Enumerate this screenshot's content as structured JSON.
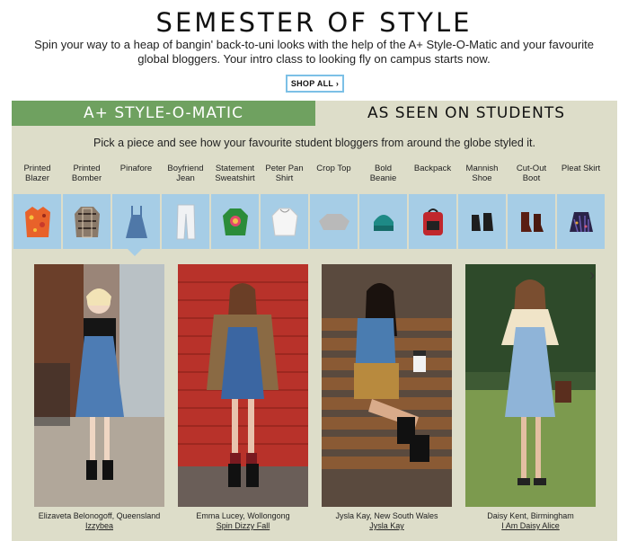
{
  "header": {
    "title": "SEMESTER OF STYLE",
    "intro": "Spin your way to a heap of bangin' back-to-uni looks with the help of the A+ Style-O-Matic and your favourite global bloggers. Your intro class to looking fly on campus starts now.",
    "shop_all_label": "SHOP ALL ›"
  },
  "tabs": [
    {
      "label": "A+ STYLE-O-MATIC",
      "active": true
    },
    {
      "label": "AS SEEN ON STUDENTS",
      "active": false
    }
  ],
  "instruction": "Pick a piece and see how your favourite student bloggers from around the globe styled it.",
  "pieces": [
    {
      "label": "Printed\nBlazer",
      "icon": "blazer-icon"
    },
    {
      "label": "Printed\nBomber",
      "icon": "bomber-icon"
    },
    {
      "label": "Pinafore",
      "icon": "pinafore-icon",
      "selected": true
    },
    {
      "label": "Boyfriend\nJean",
      "icon": "jeans-icon"
    },
    {
      "label": "Statement\nSweatshirt",
      "icon": "sweatshirt-icon"
    },
    {
      "label": "Peter Pan\nShirt",
      "icon": "shirt-icon"
    },
    {
      "label": "Crop Top",
      "icon": "crop-top-icon"
    },
    {
      "label": "Bold\nBeanie",
      "icon": "beanie-icon"
    },
    {
      "label": "Backpack",
      "icon": "backpack-icon"
    },
    {
      "label": "Mannish\nShoe",
      "icon": "shoe-icon"
    },
    {
      "label": "Cut-Out\nBoot",
      "icon": "boot-icon"
    },
    {
      "label": "Pleat Skirt",
      "icon": "skirt-icon"
    }
  ],
  "students": [
    {
      "name": "Elizaveta Belonogoff, Queensland",
      "blog": "Izzybea"
    },
    {
      "name": "Emma Lucey, Wollongong",
      "blog": "Spin Dizzy Fall"
    },
    {
      "name": "Jysla Kay, New South Wales",
      "blog": "Jysla Kay"
    },
    {
      "name": "Daisy Kent, Birmingham",
      "blog": "I Am Daisy Alice"
    }
  ],
  "navigation": {
    "next_icon": "chevron-right-icon",
    "next_label": "›"
  },
  "colors": {
    "tab_active": "#6fa160",
    "panel_bg": "#ddddc9",
    "tile_bg": "#a6cde6",
    "button_border": "#7cc0e6"
  }
}
